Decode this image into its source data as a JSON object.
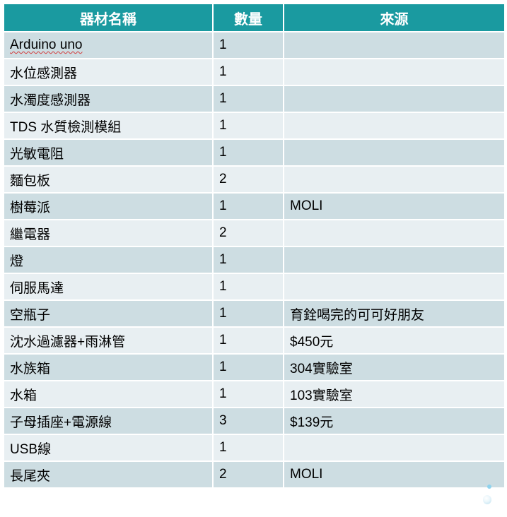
{
  "table": {
    "headers": [
      "器材名稱",
      "數量",
      "來源"
    ],
    "rows": [
      {
        "name": "Arduino uno",
        "qty": "1",
        "source": ""
      },
      {
        "name": "水位感測器",
        "qty": "1",
        "source": ""
      },
      {
        "name": "水濁度感測器",
        "qty": "1",
        "source": ""
      },
      {
        "name": "TDS 水質檢測模組",
        "qty": "1",
        "source": ""
      },
      {
        "name": "光敏電阻",
        "qty": "1",
        "source": ""
      },
      {
        "name": "麵包板",
        "qty": "2",
        "source": ""
      },
      {
        "name": "樹莓派",
        "qty": "1",
        "source": "MOLI"
      },
      {
        "name": "繼電器",
        "qty": "2",
        "source": ""
      },
      {
        "name": "燈",
        "qty": "1",
        "source": ""
      },
      {
        "name": "伺服馬達",
        "qty": "1",
        "source": ""
      },
      {
        "name": "空瓶子",
        "qty": "1",
        "source": "育銓喝完的可可好朋友"
      },
      {
        "name": "沈水過濾器+雨淋管",
        "qty": "1",
        "source": "$450元"
      },
      {
        "name": "水族箱",
        "qty": "1",
        "source": "304實驗室"
      },
      {
        "name": "水箱",
        "qty": "1",
        "source": "103實驗室"
      },
      {
        "name": "子母插座+電源線",
        "qty": "3",
        "source": "$139元"
      },
      {
        "name": "USB線",
        "qty": "1",
        "source": ""
      },
      {
        "name": "長尾夾",
        "qty": "2",
        "source": "MOLI"
      }
    ]
  },
  "colors": {
    "header_bg": "#1a9aa0",
    "row_odd": "#cddde2",
    "row_even": "#e8eff2"
  },
  "icons": [
    "water-drop-icon"
  ]
}
